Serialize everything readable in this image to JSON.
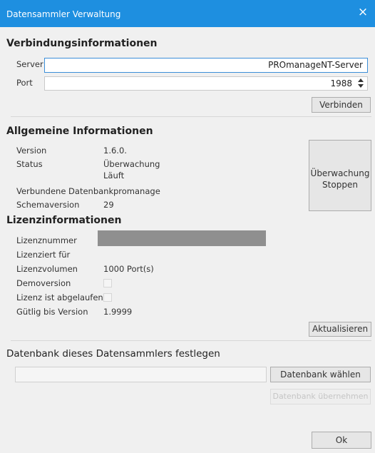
{
  "window": {
    "title": "Datensammler Verwaltung",
    "close_label": "×"
  },
  "connection": {
    "heading": "Verbindungsinformationen",
    "server_label": "Server",
    "server_value": "PROmanageNT-Server",
    "port_label": "Port",
    "port_value": "1988",
    "connect_button": "Verbinden"
  },
  "general": {
    "heading": "Allgemeine Informationen",
    "version_label": "Version",
    "version_value": "1.6.0.",
    "status_label": "Status",
    "status_value_line1": "Überwachung",
    "status_value_line2": "Läuft",
    "database_label": "Verbundene Datenbank",
    "database_value": "promanage",
    "schema_label": "Schemaversion",
    "schema_value": "29",
    "monitor_button_line1": "Überwachung",
    "monitor_button_line2": "Stoppen"
  },
  "license": {
    "heading": "Lizenzinformationen",
    "number_label": "Lizenznummer",
    "licensed_for_label": "Lizenziert für",
    "volume_label": "Lizenzvolumen",
    "volume_value": "1000 Port(s)",
    "demo_label": "Demoversion",
    "demo_checked": false,
    "expired_label": "Lizenz ist abgelaufen",
    "expired_checked": false,
    "valid_until_label": "Gütlig bis Version",
    "valid_until_value": "1.9999",
    "refresh_button": "Aktualisieren"
  },
  "database": {
    "heading": "Datenbank dieses Datensammlers festlegen",
    "path_value": "",
    "choose_button": "Datenbank wählen",
    "apply_button": "Datenbank übernehmen"
  },
  "footer": {
    "ok_button": "Ok"
  },
  "colors": {
    "titlebar": "#1e8fe0",
    "focus_border": "#3c8ed8"
  }
}
